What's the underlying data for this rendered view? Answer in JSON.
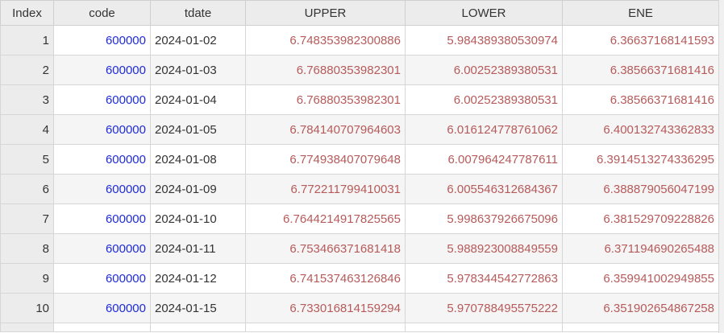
{
  "columns": [
    "Index",
    "code",
    "tdate",
    "UPPER",
    "LOWER",
    "ENE"
  ],
  "rows": [
    {
      "index": "1",
      "code": "600000",
      "tdate": "2024-01-02",
      "upper": "6.748353982300886",
      "lower": "5.984389380530974",
      "ene": "6.36637168141593"
    },
    {
      "index": "2",
      "code": "600000",
      "tdate": "2024-01-03",
      "upper": "6.76880353982301",
      "lower": "6.00252389380531",
      "ene": "6.38566371681416"
    },
    {
      "index": "3",
      "code": "600000",
      "tdate": "2024-01-04",
      "upper": "6.76880353982301",
      "lower": "6.00252389380531",
      "ene": "6.38566371681416"
    },
    {
      "index": "4",
      "code": "600000",
      "tdate": "2024-01-05",
      "upper": "6.784140707964603",
      "lower": "6.016124778761062",
      "ene": "6.400132743362833"
    },
    {
      "index": "5",
      "code": "600000",
      "tdate": "2024-01-08",
      "upper": "6.774938407079648",
      "lower": "6.007964247787611",
      "ene": "6.3914513274336295"
    },
    {
      "index": "6",
      "code": "600000",
      "tdate": "2024-01-09",
      "upper": "6.772211799410031",
      "lower": "6.005546312684367",
      "ene": "6.388879056047199"
    },
    {
      "index": "7",
      "code": "600000",
      "tdate": "2024-01-10",
      "upper": "6.7644214917825565",
      "lower": "5.998637926675096",
      "ene": "6.381529709228826"
    },
    {
      "index": "8",
      "code": "600000",
      "tdate": "2024-01-11",
      "upper": "6.753466371681418",
      "lower": "5.988923008849559",
      "ene": "6.371194690265488"
    },
    {
      "index": "9",
      "code": "600000",
      "tdate": "2024-01-12",
      "upper": "6.741537463126846",
      "lower": "5.978344542772863",
      "ene": "6.359941002949855"
    },
    {
      "index": "10",
      "code": "600000",
      "tdate": "2024-01-15",
      "upper": "6.733016814159294",
      "lower": "5.970788495575222",
      "ene": "6.351902654867258"
    }
  ],
  "colors": {
    "code_text": "#1f2bd8",
    "numeric_text": "#b65a5a",
    "header_bg": "#ececec",
    "alt_row_bg": "#f5f5f5"
  }
}
